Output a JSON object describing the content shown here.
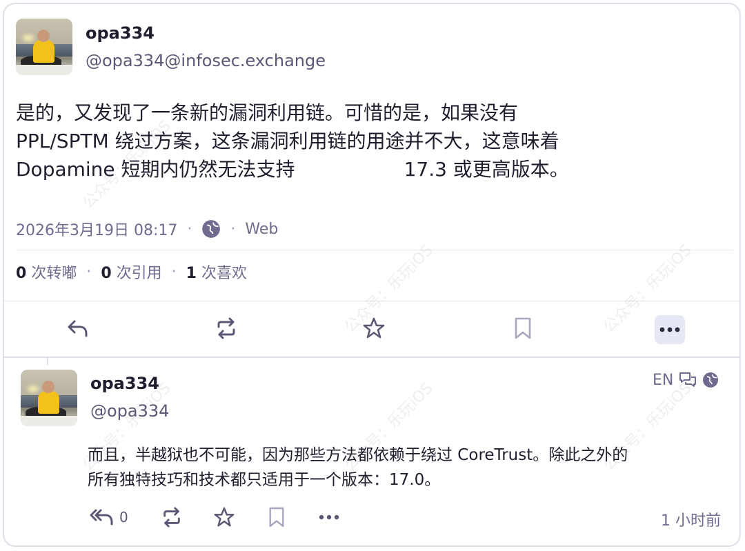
{
  "main_post": {
    "author_name": "opa334",
    "author_handle": "@opa334@infosec.exchange",
    "content_lines": [
      "是的，又发现了一条新的漏洞利用链。可惜的是，如果没有",
      "PPL/SPTM 绕过方案，这条漏洞利用链的用途并不大，这意味着",
      "Dopamine 短期内仍然无法支持",
      "17.3 或更高版本。"
    ],
    "timestamp": "2026年3月19日 08:17",
    "visibility_icon": "globe-icon",
    "source": "Web",
    "stats": {
      "boosts_count": "0",
      "boosts_label": "次转嘟",
      "quotes_count": "0",
      "quotes_label": "次引用",
      "favs_count": "1",
      "favs_label": "次喜欢"
    },
    "actions": [
      "reply-icon",
      "boost-icon",
      "star-icon",
      "bookmark-icon",
      "more-icon"
    ]
  },
  "reply_post": {
    "author_name": "opa334",
    "author_handle": "@opa334",
    "language": "EN",
    "content_lines": [
      "而且，半越狱也不可能，因为那些方法都依赖于绕过 CoreTrust。除此之外的",
      "所有独特技巧和技术都只适用于一个版本：17.0。"
    ],
    "reply_count": "0",
    "relative_time": "1 小时前",
    "actions": [
      "reply-all-icon",
      "boost-icon",
      "star-icon",
      "bookmark-icon",
      "more-icon"
    ]
  },
  "watermark": "公众号：乐玩iOS",
  "colors": {
    "text": "#1f1e2e",
    "muted": "#6e6b8e",
    "border": "#dfdde8",
    "icon": "#5b5876",
    "more_bg": "#e6e8f5"
  }
}
